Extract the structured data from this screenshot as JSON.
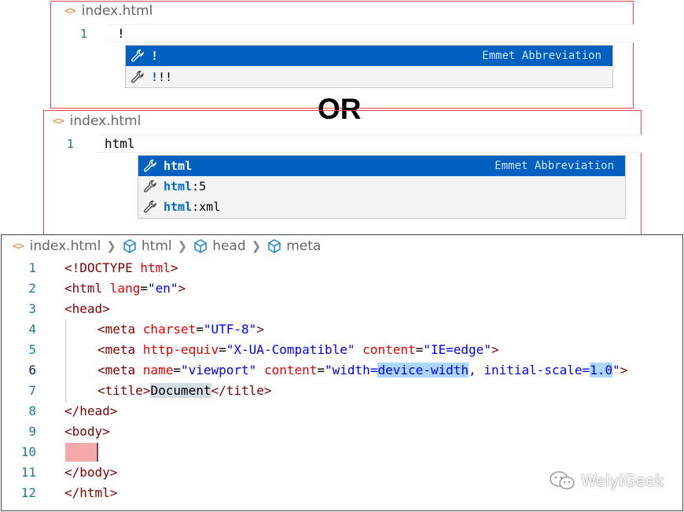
{
  "panel1": {
    "tab": "index.html",
    "line_number": "1",
    "typed": "!",
    "suggestions": [
      {
        "match": "!",
        "rest": "",
        "detail": "Emmet Abbreviation",
        "selected": true
      },
      {
        "match": "!",
        "rest": "!!",
        "detail": "",
        "selected": false
      }
    ]
  },
  "separator": "OR",
  "panel2": {
    "tab": "index.html",
    "line_number": "1",
    "typed": "html",
    "suggestions": [
      {
        "match": "html",
        "rest": "",
        "detail": "Emmet Abbreviation",
        "selected": true
      },
      {
        "match": "html",
        "rest": ":5",
        "detail": "",
        "selected": false
      },
      {
        "match": "html",
        "rest": ":xml",
        "detail": "",
        "selected": false
      }
    ]
  },
  "editor": {
    "breadcrumb": [
      "index.html",
      "html",
      "head",
      "meta"
    ],
    "line_numbers": [
      "1",
      "2",
      "3",
      "4",
      "5",
      "6",
      "7",
      "8",
      "9",
      "10",
      "11",
      "12"
    ],
    "active_line": "6",
    "code": {
      "l1_a": "<!DOCTYPE ",
      "l1_b": "html",
      "l1_c": ">",
      "l2_a": "<html ",
      "l2_b": "lang",
      "l2_c": "=",
      "l2_d": "\"en\"",
      "l2_e": ">",
      "l3": "<head>",
      "l4_a": "<meta ",
      "l4_b": "charset",
      "l4_c": "=",
      "l4_d": "\"UTF-8\"",
      "l4_e": ">",
      "l5_a": "<meta ",
      "l5_b": "http-equiv",
      "l5_c": "=",
      "l5_d": "\"X-UA-Compatible\"",
      "l5_e": " ",
      "l5_f": "content",
      "l5_g": "=",
      "l5_h": "\"IE=edge\"",
      "l5_i": ">",
      "l6_a": "<meta ",
      "l6_b": "name",
      "l6_c": "=",
      "l6_d": "\"viewport\"",
      "l6_e": " ",
      "l6_f": "content",
      "l6_g": "=",
      "l6_h": "\"width=",
      "l6_i": "device-width",
      "l6_j": ", initial-scale=",
      "l6_k": "1.0",
      "l6_l": "\"",
      "l6_m": ">",
      "l7_a": "<title>",
      "l7_b": "Document",
      "l7_c": "</title>",
      "l8": "</head>",
      "l9": "<body>",
      "l11": "</body>",
      "l12": "</html>"
    }
  },
  "watermark": "WeiyiGeek",
  "colors": {
    "red_border": "#e5484d",
    "selection": "#0060c0",
    "tag": "#800000",
    "attr": "#e50000",
    "value": "#0000ff"
  }
}
